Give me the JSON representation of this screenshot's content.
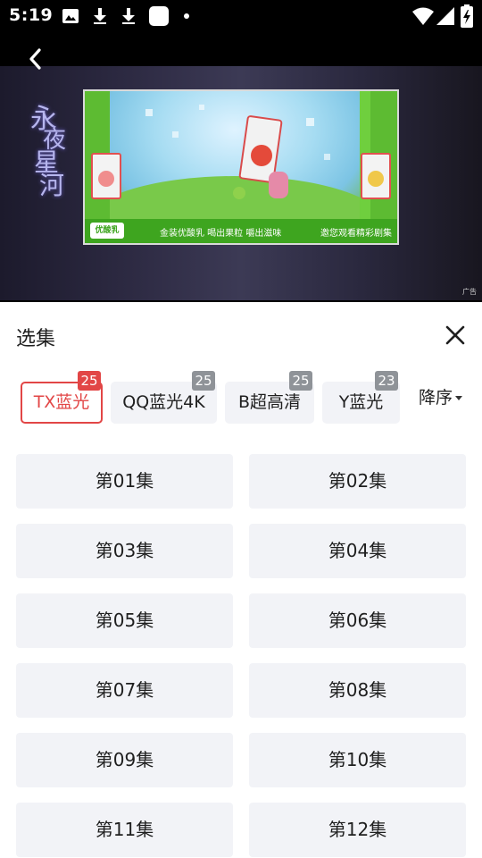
{
  "status_bar": {
    "time": "5:19",
    "left_icons": [
      "image-icon",
      "download-icon",
      "download-icon",
      "app-square-icon",
      "dot-icon"
    ],
    "right_icons": [
      "wifi-icon",
      "signal-icon",
      "battery-icon"
    ]
  },
  "video": {
    "show_logo_chars": [
      "永",
      "夜",
      "星",
      "河"
    ],
    "ad": {
      "bottom_logo": "优酸乳",
      "slogan": "金装优酸乳 喝出果粒 嚼出滋味",
      "invite": "邀您观看精彩剧集",
      "badge": "广告"
    }
  },
  "panel": {
    "title": "选集",
    "sort_label": "降序",
    "sources": [
      {
        "label": "TX蓝光",
        "count": "25",
        "active": true
      },
      {
        "label": "QQ蓝光4K",
        "count": "25",
        "active": false
      },
      {
        "label": "B超高清",
        "count": "25",
        "active": false
      },
      {
        "label": "Y蓝光",
        "count": "23",
        "active": false
      }
    ],
    "episodes": [
      "第01集",
      "第02集",
      "第03集",
      "第04集",
      "第05集",
      "第06集",
      "第07集",
      "第08集",
      "第09集",
      "第10集",
      "第11集",
      "第12集"
    ]
  },
  "colors": {
    "accent": "#e24646",
    "button_bg": "#f2f3f7",
    "badge_gray": "#8f9398"
  }
}
